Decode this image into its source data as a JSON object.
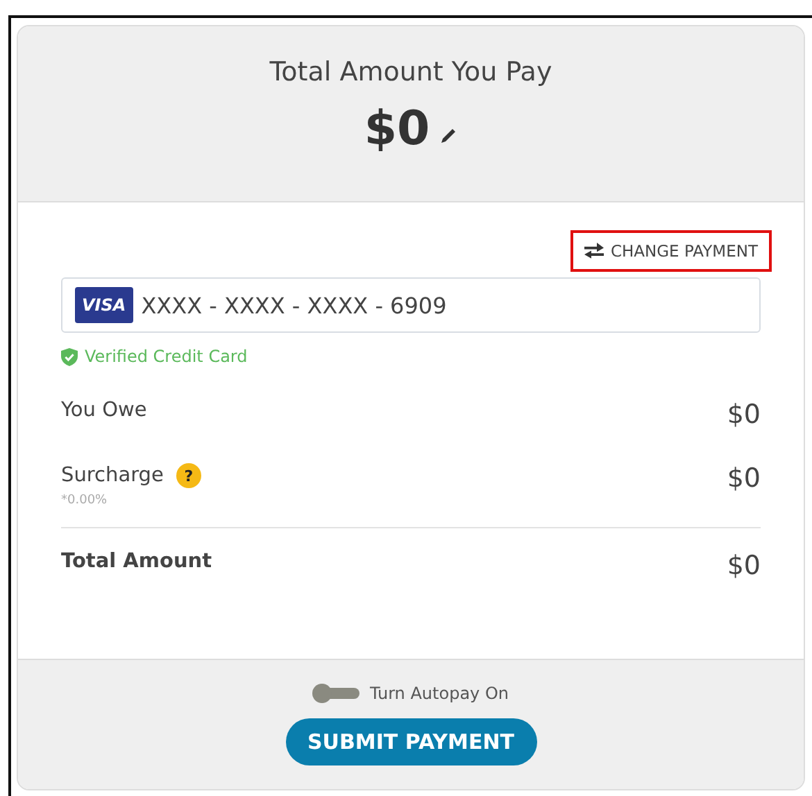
{
  "header": {
    "title": "Total Amount You Pay",
    "amount": "$0"
  },
  "change_payment": {
    "label": "CHANGE PAYMENT",
    "highlighted": true
  },
  "card": {
    "brand": "VISA",
    "number": "XXXX - XXXX - XXXX - 6909"
  },
  "verified": {
    "label": "Verified Credit Card"
  },
  "lines": [
    {
      "kind": "plain",
      "label": "You Owe",
      "value": "$0"
    },
    {
      "kind": "help",
      "label": "Surcharge",
      "help": "?",
      "note": "*0.00%",
      "value": "$0"
    },
    {
      "kind": "total",
      "label": "Total Amount",
      "value": "$0"
    }
  ],
  "autopay": {
    "label": "Turn Autopay On",
    "on": false
  },
  "submit": {
    "label": "SUBMIT PAYMENT"
  }
}
